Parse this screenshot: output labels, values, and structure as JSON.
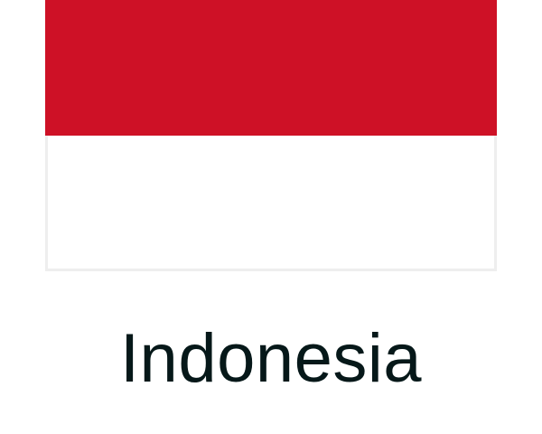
{
  "flag": {
    "top_color": "#ce1126",
    "bottom_color": "#ffffff",
    "border_color": "#eeeeee"
  },
  "country": {
    "name": "Indonesia",
    "text_color": "#061819"
  }
}
